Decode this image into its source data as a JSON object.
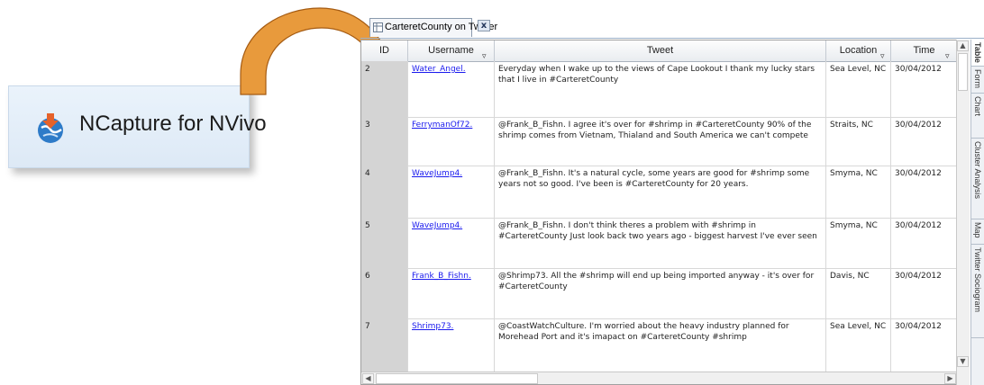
{
  "ncapture": {
    "label": "NCapture for NVivo",
    "icon": "ncapture-globe-icon"
  },
  "tab": {
    "label": "CarteretCounty on Twitter",
    "close": "x"
  },
  "columns": {
    "id": "ID",
    "username": "Username",
    "tweet": "Tweet",
    "location": "Location",
    "time": "Time"
  },
  "rows": [
    {
      "id": "2",
      "username": "Water_Angel.",
      "tweet": "Everyday when I wake up to the views of Cape Lookout I thank my lucky stars that I live in #CarteretCounty",
      "location": "Sea Level, NC",
      "time": "30/04/2012"
    },
    {
      "id": "3",
      "username": "FerrymanOf72.",
      "tweet": "@Frank_B_Fishn. I agree it's over for #shrimp in #CarteretCounty 90% of the shrimp comes from Vietnam, Thialand and South America we can't compete",
      "location": "Straits, NC",
      "time": "30/04/2012"
    },
    {
      "id": "4",
      "username": "WaveJump4.",
      "tweet": "@Frank_B_Fishn. It's a natural cycle, some years are good for #shrimp some years not so good. I've been is #CarteretCounty for 20 years.",
      "location": "Smyma, NC",
      "time": "30/04/2012"
    },
    {
      "id": "5",
      "username": "WaveJump4.",
      "tweet": "@Frank_B_Fishn. I don't think theres a problem with #shrimp in #CarteretCounty Just look back two years ago - biggest harvest I've ever seen",
      "location": "Smyma, NC",
      "time": "30/04/2012"
    },
    {
      "id": "6",
      "username": "Frank_B_Fishn.",
      "tweet": "@Shrimp73. All the #shrimp will end up being imported anyway - it's over for #CarteretCounty",
      "location": "Davis, NC",
      "time": "30/04/2012"
    },
    {
      "id": "7",
      "username": "Shrimp73.",
      "tweet": "@CoastWatchCulture. I'm worried about the heavy industry planned for Morehead Port and it's imapact on #CarteretCounty #shrimp",
      "location": "Sea Level, NC",
      "time": "30/04/2012"
    }
  ],
  "sidetabs": [
    "Table",
    "Form",
    "Chart",
    "Cluster Analysis",
    "Map",
    "Twitter Sociogram"
  ],
  "colors": {
    "link": "#1a1aee",
    "arrow_fill": "#e89a3c",
    "arrow_stroke": "#a55b12"
  }
}
